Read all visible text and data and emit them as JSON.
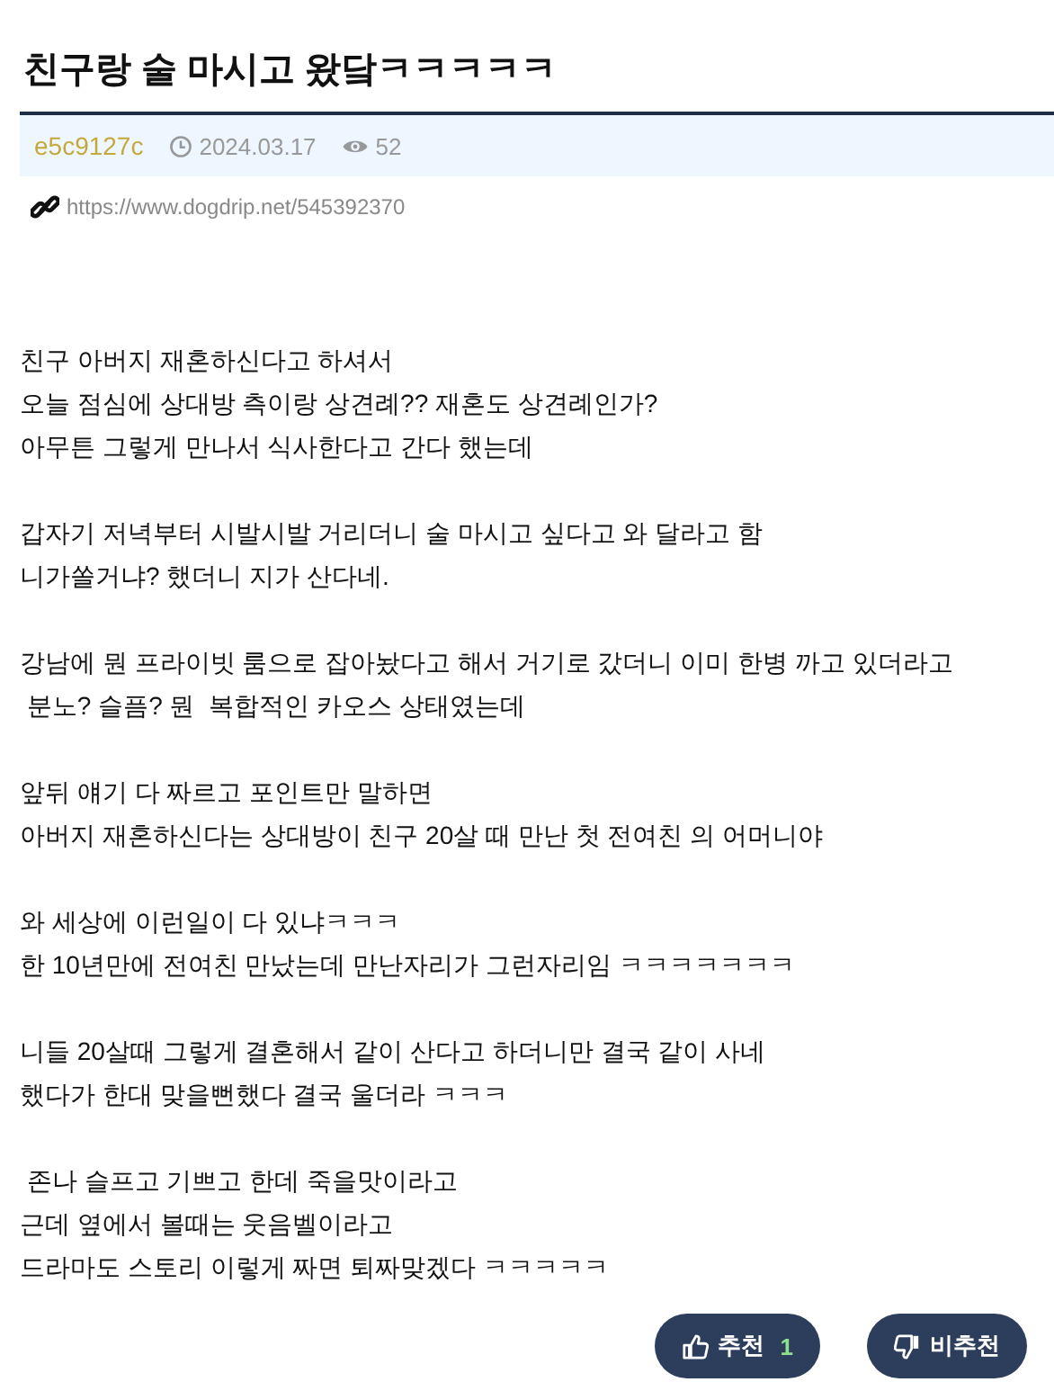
{
  "title": "친구랑 술 마시고 왔닼ㅋㅋㅋㅋㅋ",
  "meta": {
    "author": "e5c9127c",
    "date": "2024.03.17",
    "views": "52"
  },
  "link": "https://www.dogdrip.net/545392370",
  "paragraphs": [
    [
      "친구 아버지 재혼하신다고 하셔서",
      "오늘 점심에 상대방 측이랑 상견례?? 재혼도 상견례인가?",
      "아무튼 그렇게 만나서 식사한다고 간다 했는데"
    ],
    [
      "갑자기 저녁부터 시발시발 거리더니 술 마시고 싶다고 와 달라고 함",
      "니가쏠거냐? 했더니 지가 산다네."
    ],
    [
      "강남에 뭔 프라이빗 룸으로 잡아놨다고 해서 거기로 갔더니 이미 한병 까고 있더라고",
      " 분노? 슬픔? 뭔  복합적인 카오스 상태였는데"
    ],
    [
      "앞뒤 얘기 다 짜르고 포인트만 말하면",
      "아버지 재혼하신다는 상대방이 친구 20살 때 만난 첫 전여친 의 어머니야"
    ],
    [
      "와 세상에 이런일이 다 있냐ㅋㅋㅋ",
      "한 10년만에 전여친 만났는데 만난자리가 그런자리임 ㅋㅋㅋㅋㅋㅋㅋ"
    ],
    [
      "니들 20살때 그렇게 결혼해서 같이 산다고 하더니만 결국 같이 사네",
      "했다가 한대 맞을뻔했다 결국 울더라 ㅋㅋㅋ"
    ],
    [
      " 존나 슬프고 기쁘고 한데 죽을맛이라고",
      "근데 옆에서 볼때는 웃음벨이라고",
      "드라마도 스토리 이렇게 짜면 퇴짜맞겠다 ㅋㅋㅋㅋㅋ"
    ]
  ],
  "votes": [
    {
      "kind": "up",
      "label": "추천",
      "count": "1"
    },
    {
      "kind": "down",
      "label": "비추천"
    }
  ]
}
